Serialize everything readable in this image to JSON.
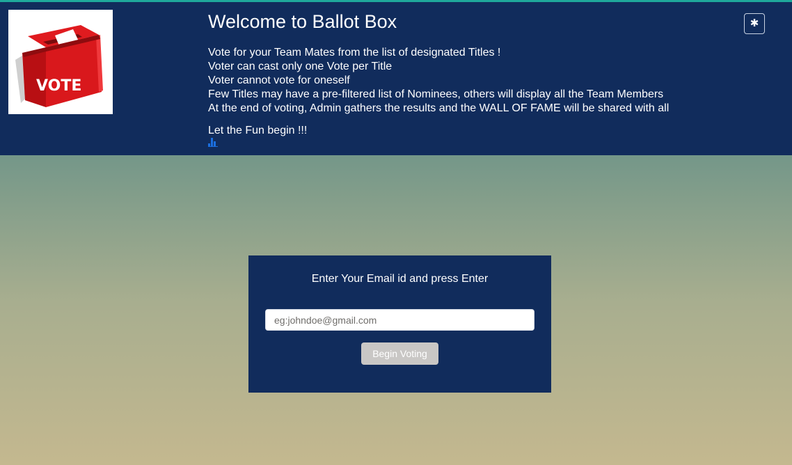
{
  "header": {
    "title": "Welcome to Ballot Box",
    "logo_text": "VOTE",
    "rules": [
      "Vote for your Team Mates from the list of designated Titles !",
      "Voter can cast only one Vote per Title",
      "Voter cannot vote for oneself",
      "Few Titles may have a pre-filtered list of Nominees, others will display all the Team Members",
      "At the end of voting, Admin gathers the results and the WALL OF FAME will be shared with all"
    ],
    "fun_line": "Let the Fun begin !!!",
    "settings_icon": "asterisk-icon",
    "settings_glyph": "✱",
    "chart_icon": "bar-chart-icon"
  },
  "login": {
    "prompt": "Enter Your Email id and press Enter",
    "email_value": "",
    "email_placeholder": "eg:johndoe@gmail.com",
    "button_label": "Begin Voting"
  },
  "colors": {
    "header_bg": "#112c5c",
    "accent_strip": "#1fa99b",
    "button_disabled": "#c9c7c5",
    "logo_red": "#d9181c"
  }
}
